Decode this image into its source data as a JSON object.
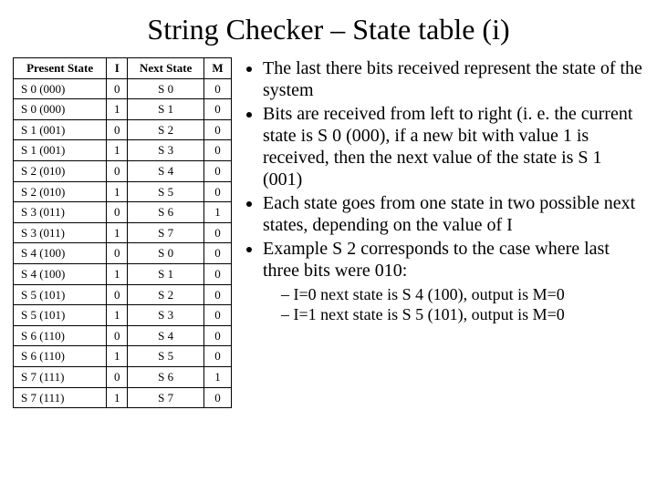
{
  "title": "String Checker – State table (i)",
  "table": {
    "headers": {
      "present": "Present State",
      "i": "I",
      "next": "Next State",
      "m": "M"
    },
    "rows": [
      {
        "present": "S 0 (000)",
        "i": "0",
        "next": "S 0",
        "m": "0"
      },
      {
        "present": "S 0 (000)",
        "i": "1",
        "next": "S 1",
        "m": "0"
      },
      {
        "present": "S 1 (001)",
        "i": "0",
        "next": "S 2",
        "m": "0"
      },
      {
        "present": "S 1 (001)",
        "i": "1",
        "next": "S 3",
        "m": "0"
      },
      {
        "present": "S 2 (010)",
        "i": "0",
        "next": "S 4",
        "m": "0"
      },
      {
        "present": "S 2 (010)",
        "i": "1",
        "next": "S 5",
        "m": "0"
      },
      {
        "present": "S 3 (011)",
        "i": "0",
        "next": "S 6",
        "m": "1"
      },
      {
        "present": "S 3 (011)",
        "i": "1",
        "next": "S 7",
        "m": "0"
      },
      {
        "present": "S 4 (100)",
        "i": "0",
        "next": "S 0",
        "m": "0"
      },
      {
        "present": "S 4 (100)",
        "i": "1",
        "next": "S 1",
        "m": "0"
      },
      {
        "present": "S 5 (101)",
        "i": "0",
        "next": "S 2",
        "m": "0"
      },
      {
        "present": "S 5 (101)",
        "i": "1",
        "next": "S 3",
        "m": "0"
      },
      {
        "present": "S 6 (110)",
        "i": "0",
        "next": "S 4",
        "m": "0"
      },
      {
        "present": "S 6 (110)",
        "i": "1",
        "next": "S 5",
        "m": "0"
      },
      {
        "present": "S 7 (111)",
        "i": "0",
        "next": "S 6",
        "m": "1"
      },
      {
        "present": "S 7 (111)",
        "i": "1",
        "next": "S 7",
        "m": "0"
      }
    ]
  },
  "bullets": [
    "The last there bits received represent the state of the system",
    "Bits are received from left to right (i. e. the current state is S 0 (000), if a new bit with value 1 is received, then the next value of the state is S 1 (001)",
    "Each state goes from one state in two possible next states, depending on the value of I",
    "Example S 2 corresponds to the case where last three bits were 010:"
  ],
  "sub": [
    "– I=0 next state is S 4 (100), output is M=0",
    "– I=1 next state is S 5 (101), output is M=0"
  ]
}
